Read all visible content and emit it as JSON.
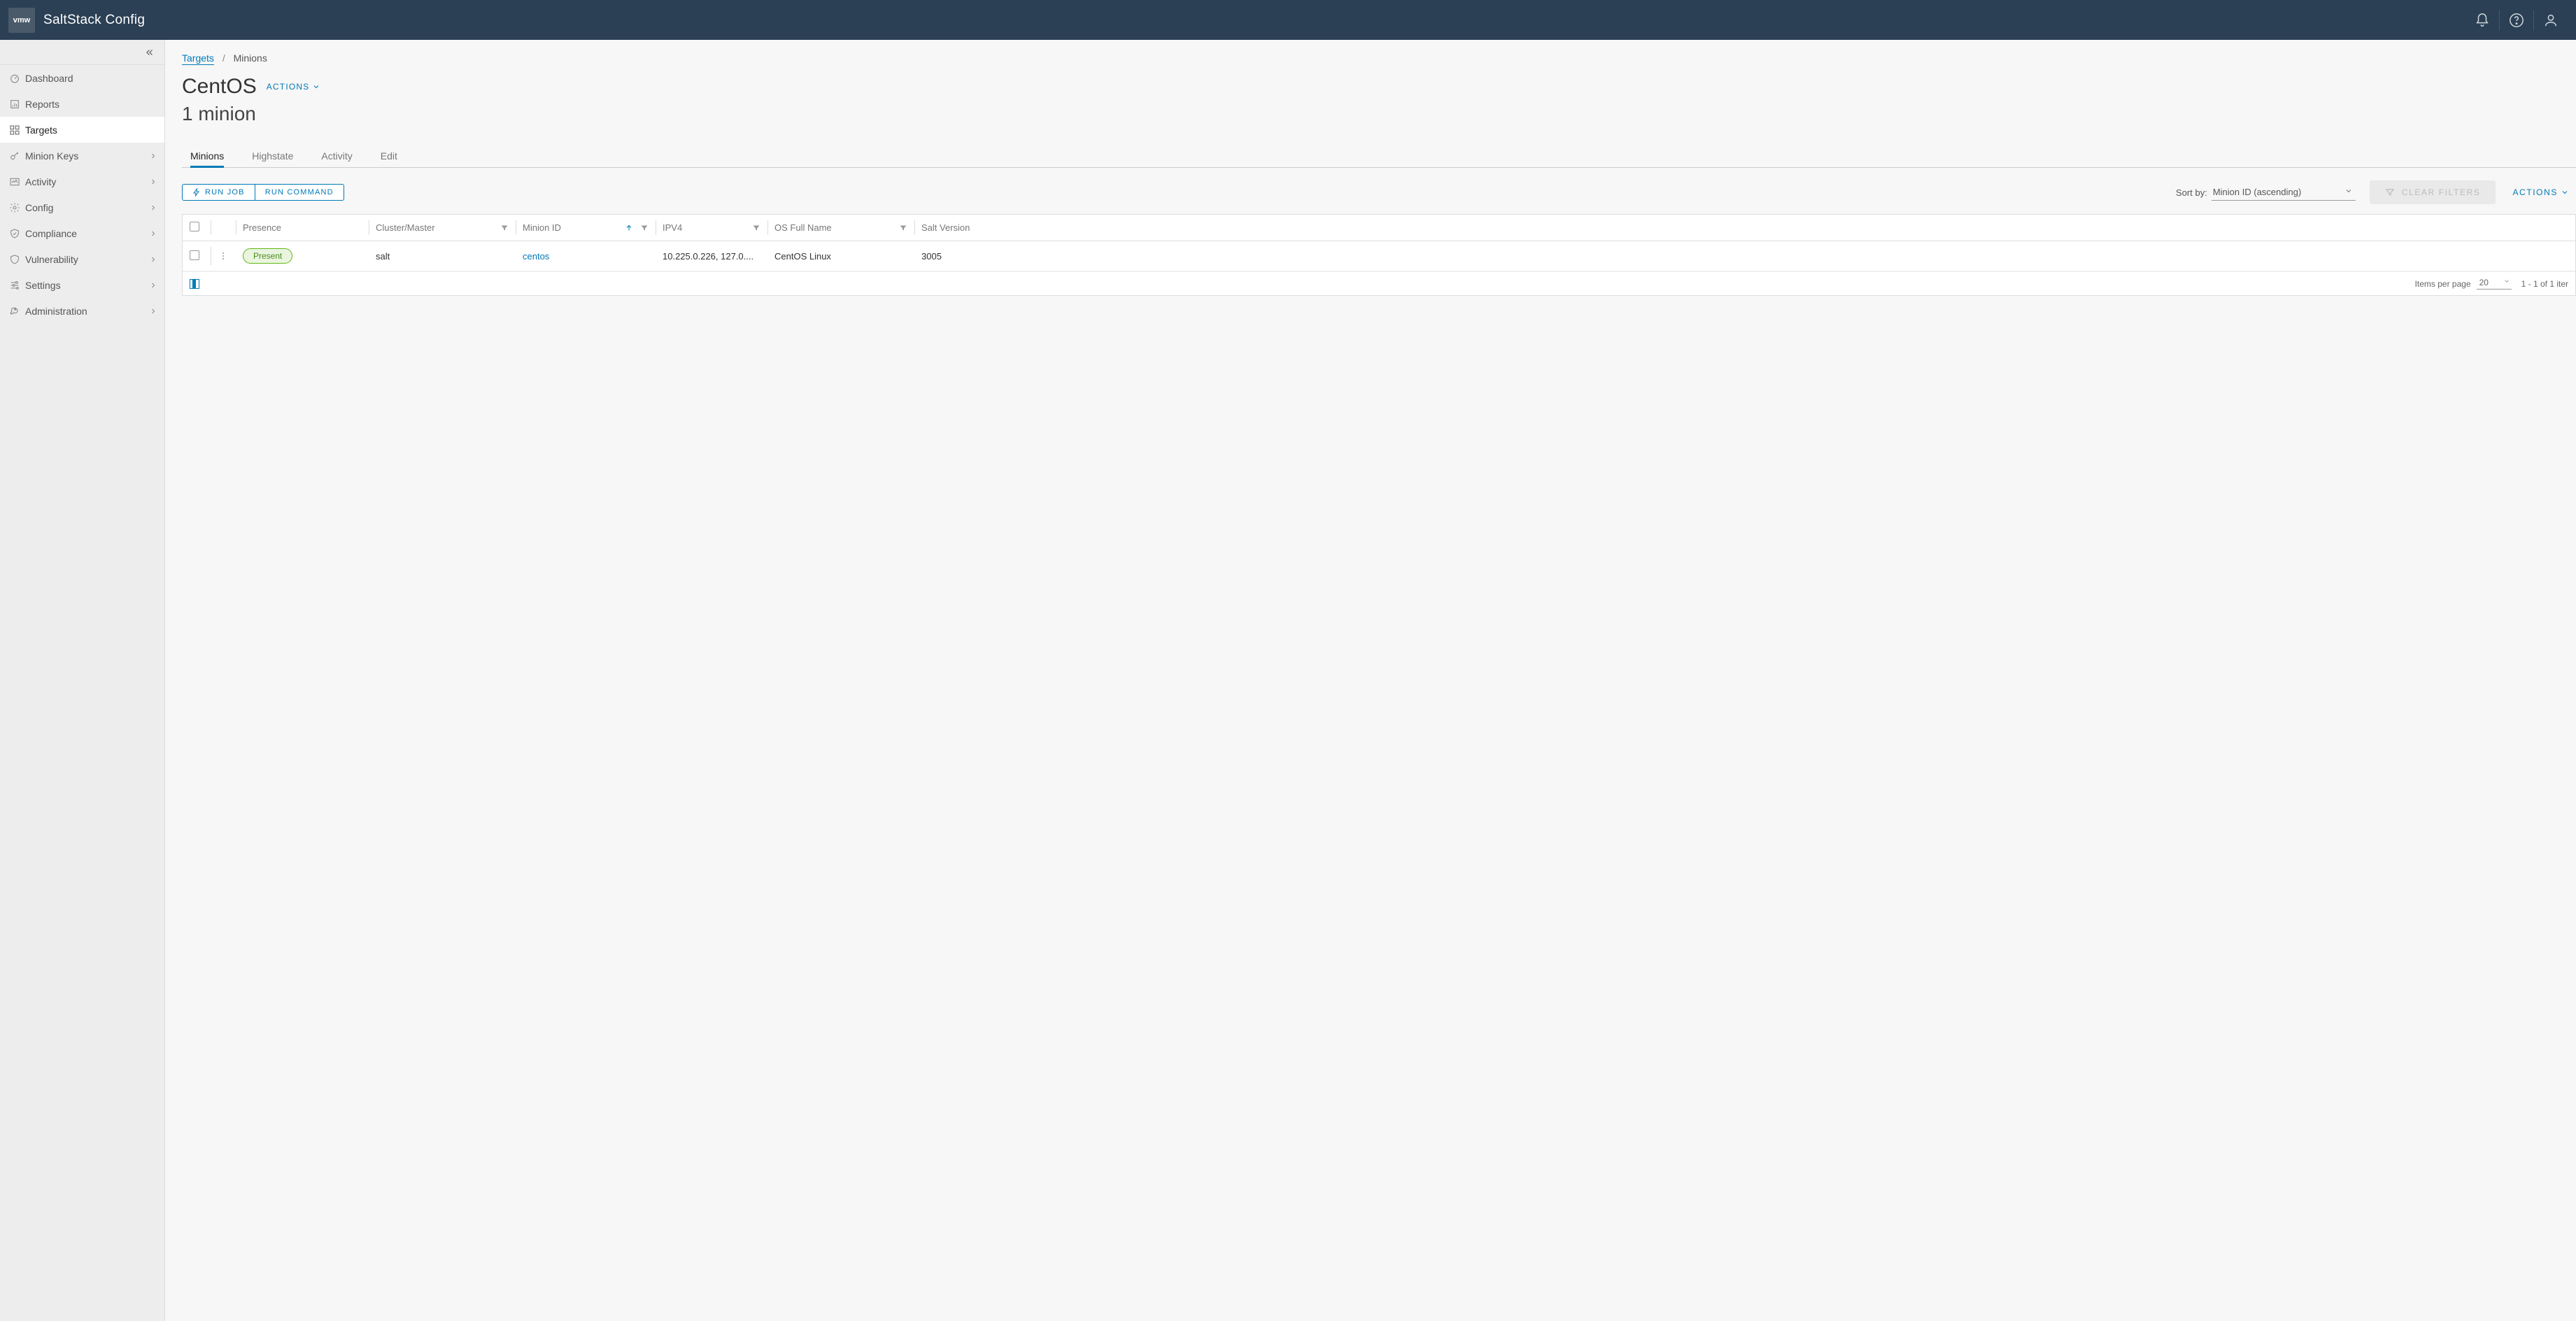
{
  "header": {
    "logo_text": "vmw",
    "app_title": "SaltStack Config"
  },
  "sidebar": {
    "items": [
      {
        "label": "Dashboard",
        "icon": "dashboard",
        "expandable": false
      },
      {
        "label": "Reports",
        "icon": "reports",
        "expandable": false
      },
      {
        "label": "Targets",
        "icon": "targets",
        "expandable": false,
        "active": true
      },
      {
        "label": "Minion Keys",
        "icon": "keys",
        "expandable": true
      },
      {
        "label": "Activity",
        "icon": "activity",
        "expandable": true
      },
      {
        "label": "Config",
        "icon": "config",
        "expandable": true
      },
      {
        "label": "Compliance",
        "icon": "compliance",
        "expandable": true
      },
      {
        "label": "Vulnerability",
        "icon": "vulnerability",
        "expandable": true
      },
      {
        "label": "Settings",
        "icon": "settings",
        "expandable": true
      },
      {
        "label": "Administration",
        "icon": "administration",
        "expandable": true
      }
    ]
  },
  "breadcrumb": {
    "root": "Targets",
    "sep": "/",
    "current": "Minions"
  },
  "page": {
    "title": "CentOS",
    "title_actions": "ACTIONS",
    "subtitle": "1 minion"
  },
  "tabs": [
    {
      "label": "Minions",
      "active": true
    },
    {
      "label": "Highstate"
    },
    {
      "label": "Activity"
    },
    {
      "label": "Edit"
    }
  ],
  "toolbar": {
    "run_job": "RUN JOB",
    "run_command": "RUN COMMAND",
    "sort_by_label": "Sort by:",
    "sort_value": "Minion ID (ascending)",
    "clear_filters": "CLEAR FILTERS",
    "actions": "ACTIONS"
  },
  "columns": {
    "presence": "Presence",
    "cluster_master": "Cluster/Master",
    "minion_id": "Minion ID",
    "ipv4": "IPV4",
    "os_full_name": "OS Full Name",
    "salt_version": "Salt Version"
  },
  "rows": [
    {
      "presence": "Present",
      "cluster_master": "salt",
      "minion_id": "centos",
      "ipv4": "10.225.0.226, 127.0....",
      "os_full_name": "CentOS Linux",
      "salt_version": "3005"
    }
  ],
  "footer": {
    "items_per_page_label": "Items per page",
    "items_per_page_value": "20",
    "range": "1 - 1 of 1 iter"
  }
}
